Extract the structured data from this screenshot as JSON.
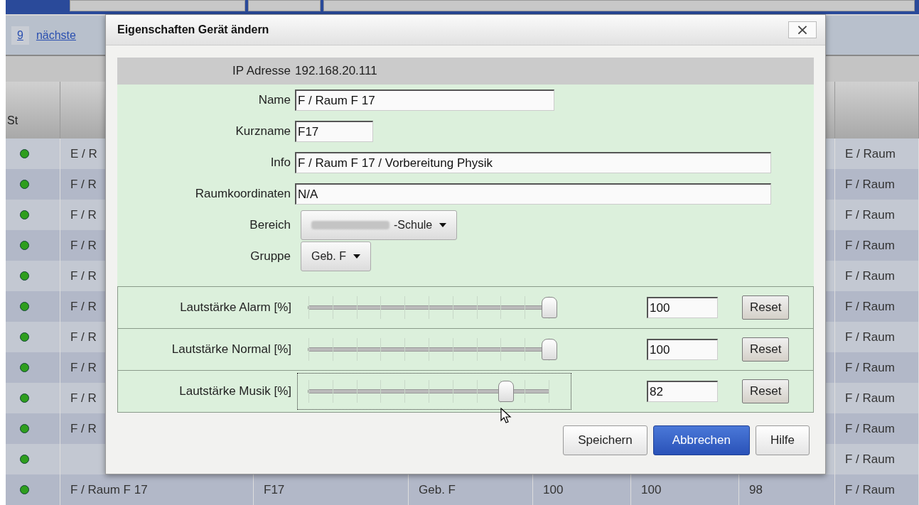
{
  "pager": {
    "pages": [
      {
        "label": "9",
        "selected": false
      }
    ],
    "next": "nächste"
  },
  "table": {
    "columns": [
      "St"
    ],
    "rows": [
      {
        "color": "#2e9e1e",
        "cells": [
          "E / R",
          "",
          "",
          "",
          "",
          "",
          ""
        ],
        "last": "E / Raum"
      },
      {
        "color": "#2e9e1e",
        "cells": [
          "F / R",
          "",
          "",
          "",
          "",
          "",
          ""
        ],
        "last": "F / Raum"
      },
      {
        "color": "#2e9e1e",
        "cells": [
          "F / R",
          "",
          "",
          "",
          "",
          "",
          ""
        ],
        "last": "F / Raum"
      },
      {
        "color": "#2e9e1e",
        "cells": [
          "F / R",
          "",
          "",
          "",
          "",
          "",
          ""
        ],
        "last": "F / Raum"
      },
      {
        "color": "#2e9e1e",
        "cells": [
          "F / R",
          "",
          "",
          "",
          "",
          "",
          ""
        ],
        "last": "F / Raum"
      },
      {
        "color": "#2e9e1e",
        "cells": [
          "F / R",
          "",
          "",
          "",
          "",
          "",
          ""
        ],
        "last": "F / Raum"
      },
      {
        "color": "#2e9e1e",
        "cells": [
          "F / R",
          "",
          "",
          "",
          "",
          "",
          ""
        ],
        "last": "F / Raum"
      },
      {
        "color": "#2e9e1e",
        "cells": [
          "F / R",
          "",
          "",
          "",
          "",
          "",
          ""
        ],
        "last": "F / Raum"
      },
      {
        "color": "#2e9e1e",
        "cells": [
          "F / R",
          "",
          "",
          "",
          "",
          "",
          ""
        ],
        "last": "F / Raum"
      },
      {
        "color": "#2e9e1e",
        "cells": [
          "F / R",
          "",
          "",
          "",
          "",
          "",
          ""
        ],
        "last": "F / Raum"
      },
      {
        "color": "#2e9e1e",
        "cells": [
          "",
          "",
          "",
          "",
          "",
          "",
          ""
        ],
        "last": "F / Raum"
      },
      {
        "color": "#2e9e1e",
        "cells": [
          "F / Raum F 17",
          "F17",
          "Geb. F",
          "100",
          "100",
          "98"
        ],
        "last": "F / Raum"
      }
    ]
  },
  "dialog": {
    "title": "Eigenschaften Gerät ändern",
    "close": "×",
    "ip": {
      "label": "IP Adresse",
      "value": "192.168.20.111"
    },
    "fields": [
      {
        "kind": "text",
        "label": "Name",
        "value": "F / Raum F 17"
      },
      {
        "kind": "text",
        "label": "Kurzname",
        "value": "F17"
      },
      {
        "kind": "text",
        "label": "Info",
        "value": "F / Raum F 17 / Vorbereitung Physik"
      },
      {
        "kind": "text",
        "label": "Raumkoordinaten",
        "value": "N/A"
      },
      {
        "kind": "select",
        "label": "Bereich",
        "value": "-Schule",
        "redacted": true
      },
      {
        "kind": "select",
        "label": "Gruppe",
        "value": "Geb. F"
      }
    ],
    "sliders": [
      {
        "label": "Lautstärke Alarm [%]",
        "level": 1.0,
        "value": "100",
        "reset": "Reset",
        "focused": false
      },
      {
        "label": "Lautstärke Normal [%]",
        "level": 1.0,
        "value": "100",
        "reset": "Reset",
        "focused": false
      },
      {
        "label": "Lautstärke Musik [%]",
        "level": 0.82,
        "value": "82",
        "reset": "Reset",
        "focused": true
      }
    ],
    "buttons": [
      {
        "label": "Speichern",
        "primary": false
      },
      {
        "label": "Abbrechen",
        "primary": true
      },
      {
        "label": "Hilfe",
        "primary": false
      }
    ]
  }
}
